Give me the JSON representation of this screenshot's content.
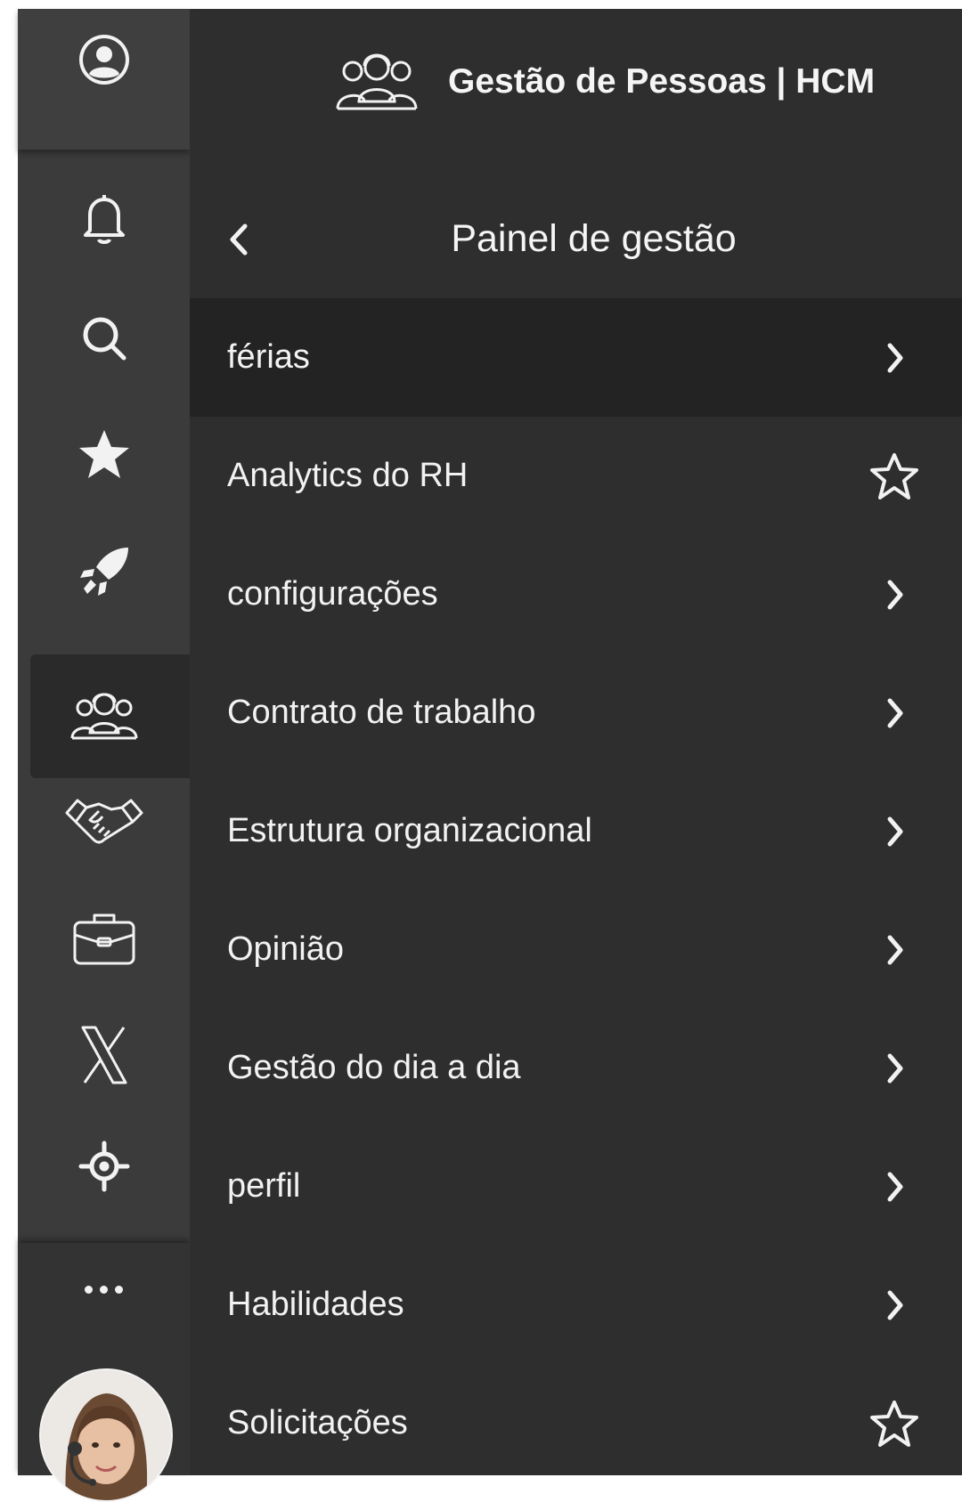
{
  "header": {
    "app_title": "Gestão de Pessoas | HCM",
    "app_icon": "people-group-icon"
  },
  "subheader": {
    "title": "Painel de gestão",
    "back_icon": "chevron-left-icon"
  },
  "rail": {
    "items": [
      {
        "icon": "user-circle-icon"
      },
      {
        "icon": "bell-icon"
      },
      {
        "icon": "search-icon"
      },
      {
        "icon": "star-filled-icon"
      },
      {
        "icon": "rocket-icon"
      },
      {
        "icon": "people-group-icon",
        "active": true
      },
      {
        "icon": "handshake-icon"
      },
      {
        "icon": "briefcase-icon"
      },
      {
        "icon": "x-logo-icon"
      },
      {
        "icon": "crosshair-icon"
      },
      {
        "icon": "more-dots-icon"
      },
      {
        "icon": "assistant-avatar"
      }
    ]
  },
  "menu": {
    "items": [
      {
        "label": "férias",
        "trailing": "chevron-right-icon",
        "active": true
      },
      {
        "label": "Analytics do RH",
        "trailing": "star-outline-icon"
      },
      {
        "label": "configurações",
        "trailing": "chevron-right-icon"
      },
      {
        "label": "Contrato de trabalho",
        "trailing": "chevron-right-icon"
      },
      {
        "label": "Estrutura organizacional",
        "trailing": "chevron-right-icon"
      },
      {
        "label": "Opinião",
        "trailing": "chevron-right-icon"
      },
      {
        "label": "Gestão do dia a dia",
        "trailing": "chevron-right-icon"
      },
      {
        "label": "perfil",
        "trailing": "chevron-right-icon"
      },
      {
        "label": "Habilidades",
        "trailing": "chevron-right-icon"
      },
      {
        "label": "Solicitações",
        "trailing": "star-outline-icon"
      }
    ]
  },
  "colors": {
    "background": "#2e2e2e",
    "rail": "#3b3b3b",
    "active_item": "#232323",
    "text": "#f2f2f2"
  }
}
